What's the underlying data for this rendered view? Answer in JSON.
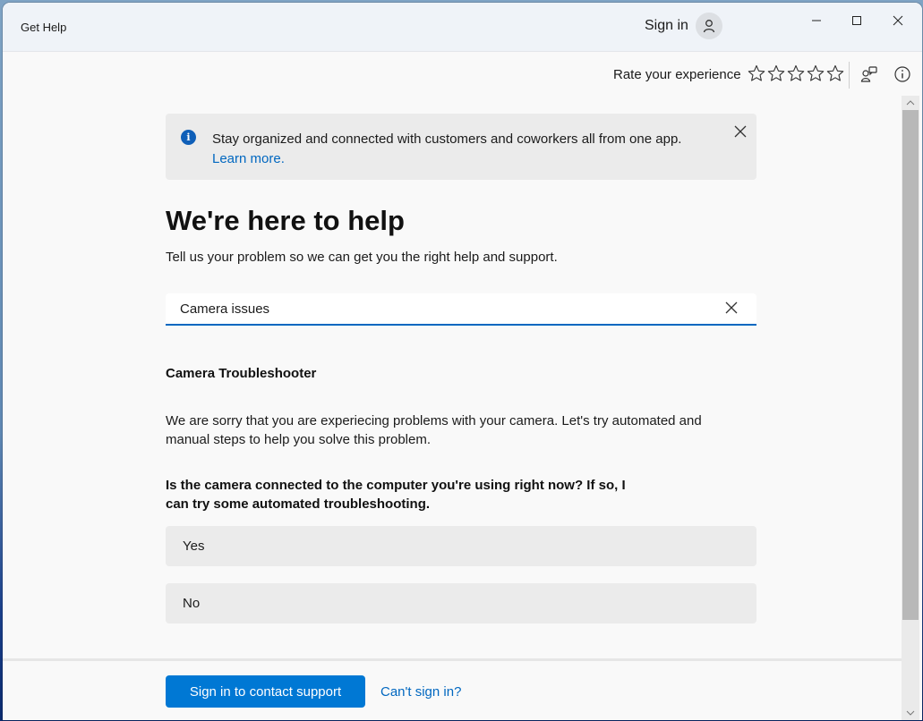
{
  "window": {
    "title": "Get Help",
    "sign_in_label": "Sign in",
    "controls": [
      "minimize",
      "maximize",
      "close"
    ]
  },
  "toolbar": {
    "rate_label": "Rate your experience",
    "rating": 0,
    "rating_max": 5,
    "icons": [
      "feedback-icon",
      "info-icon"
    ]
  },
  "banner": {
    "message": "Stay organized and connected with customers and coworkers all from one app.",
    "link": "Learn more."
  },
  "main": {
    "title": "We're here to help",
    "subtitle": "Tell us your problem so we can get you the right help and support.",
    "search": {
      "value": "Camera issues",
      "placeholder": ""
    },
    "section_title": "Camera Troubleshooter",
    "description": "We are sorry that you are experiecing problems with your camera. Let's try automated and manual steps to help you solve this problem.",
    "question": "Is the camera connected to the computer you're using right now? If so, I can try some automated troubleshooting.",
    "choices": [
      "Yes",
      "No"
    ]
  },
  "footer": {
    "primary_button": "Sign in to contact support",
    "link": "Can't sign in?"
  },
  "colors": {
    "accent": "#0078d4",
    "link": "#0067c0",
    "info": "#0f5fb8"
  }
}
